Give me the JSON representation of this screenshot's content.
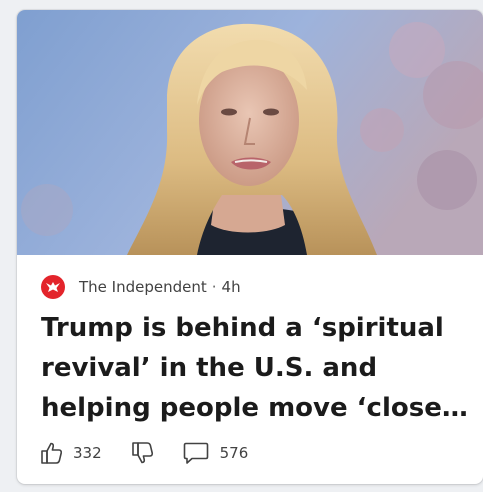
{
  "card": {
    "source": "The Independent",
    "separator": "·",
    "age": "4h",
    "headline": "Trump is behind a ‘spiritual revival’ in the U.S. and helping people move ‘closer to God’",
    "likes": "332",
    "comments": "576"
  },
  "icons": {
    "logo": "independent-eagle-logo-icon",
    "like": "thumbs-up-icon",
    "dislike": "thumbs-down-icon",
    "comment": "comment-bubble-icon"
  },
  "colors": {
    "logo_red": "#e3242b",
    "headline": "#1b1b1b",
    "meta_text": "#424242"
  }
}
